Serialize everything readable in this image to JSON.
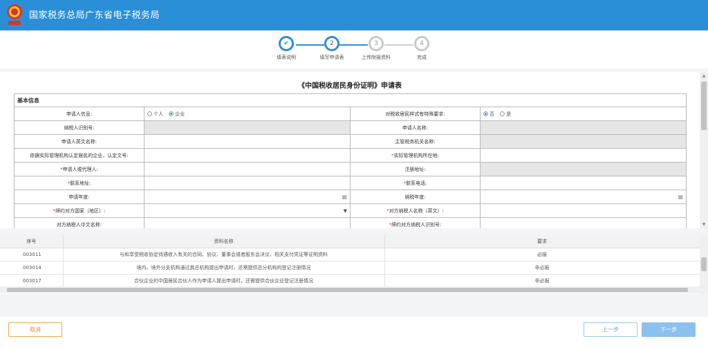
{
  "header": {
    "title": "国家税务总局广东省电子税务局",
    "brand_color": "#2b8fd8"
  },
  "steps": [
    {
      "num": "✔",
      "label": "填表说明"
    },
    {
      "num": "2",
      "label": "填写申请表"
    },
    {
      "num": "3",
      "label": "上传附报资料"
    },
    {
      "num": "4",
      "label": "完成"
    }
  ],
  "form": {
    "title": "《中国税收居民身份证明》申请表",
    "section": "基本信息",
    "applicant_type_label": "申请人信息:",
    "applicant_type_options": [
      "个人",
      "企业"
    ],
    "applicant_type_selected": "企业",
    "special_req_label": "对税收居民样式有特殊要求:",
    "special_req_options": [
      "否",
      "是"
    ],
    "special_req_selected": "否",
    "taxpayer_id_label": "纳税人识别号:",
    "applicant_name_label": "申请人名称:",
    "english_name_label": "申请人英文名称:",
    "tax_authority_label": "主管税务机关名称:",
    "resident_doc_label": "依据实际管理机构认定居民的企业，认定文号:",
    "mgmt_location_label": "实际管理机构所在地:",
    "agent_label": "申请人或代理人:",
    "reg_address_label": "注册地址:",
    "contact_addr_label": "联系地址:",
    "contact_phone_label": "联系电话:",
    "apply_year_label": "申请年度:",
    "tax_year_label": "纳税年度:",
    "country_label": "缔约对方国家（地区）:",
    "counter_en_name_label": "对方纳税人名称（英文）:",
    "counter_cn_name_label": "对方纳税人中文名称:",
    "counter_id_label": "缔约对方纳税人识别号:"
  },
  "docs": {
    "headers": [
      "序号",
      "资料名称",
      "要求"
    ],
    "rows": [
      {
        "code": "003011",
        "name": "与和享受税收协定待遇收入有关的合同、协议、董事会或者股东会决议、相关支付凭证等证明资料",
        "req": "必报"
      },
      {
        "code": "003014",
        "name": "境内、境外分支机构通过其总机构提出申请时，还需提供总分机构的登记注册情况",
        "req": "非必报"
      },
      {
        "code": "003017",
        "name": "合伙企业的中国居民合伙人作为申请人提出申请时，还需提供合伙企业登记注册情况",
        "req": "非必报"
      }
    ]
  },
  "footer": {
    "cancel": "取消",
    "prev": "上一步",
    "next": "下一步"
  }
}
